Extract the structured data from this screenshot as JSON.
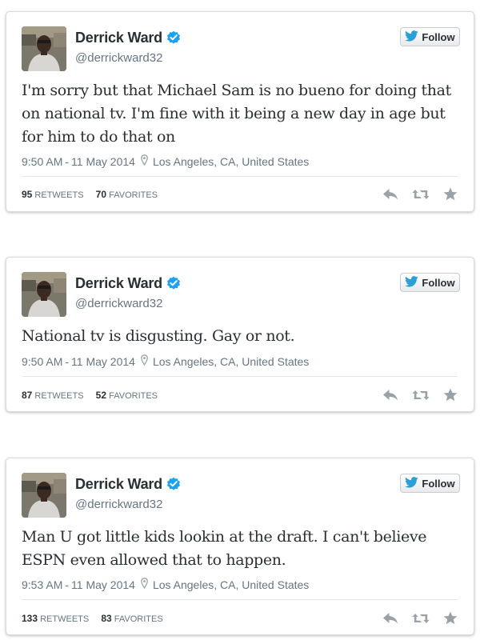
{
  "colors": {
    "verified": "#1da1f2",
    "bird": "#2a9fd8",
    "text": "#292f33",
    "muted": "#66757f",
    "action_icon": "#9aa2a8"
  },
  "tweets": [
    {
      "name": "Derrick Ward",
      "handle": "@derrickward32",
      "follow_label": "Follow",
      "text": "I'm sorry but that Michael Sam is no bueno for doing that on national tv. I'm fine with it being a new day in age but for him to do that on",
      "time": "9:50 AM",
      "date": "11 May 2014",
      "location": "Los Angeles, CA, United States",
      "retweets": "95",
      "retweets_label": "RETWEETS",
      "favorites": "70",
      "favorites_label": "FAVORITES"
    },
    {
      "name": "Derrick Ward",
      "handle": "@derrickward32",
      "follow_label": "Follow",
      "text": "National tv is disgusting. Gay or not.",
      "time": "9:50 AM",
      "date": "11 May 2014",
      "location": "Los Angeles, CA, United States",
      "retweets": "87",
      "retweets_label": "RETWEETS",
      "favorites": "52",
      "favorites_label": "FAVORITES"
    },
    {
      "name": "Derrick Ward",
      "handle": "@derrickward32",
      "follow_label": "Follow",
      "text": "Man U got little kids lookin at the draft. I can't believe ESPN even allowed that to happen.",
      "time": "9:53 AM",
      "date": "11 May 2014",
      "location": "Los Angeles, CA, United States",
      "retweets": "133",
      "retweets_label": "RETWEETS",
      "favorites": "83",
      "favorites_label": "FAVORITES"
    }
  ],
  "icons": {
    "verified": "verified-badge-icon",
    "bird": "twitter-bird-icon",
    "location": "map-pin-icon",
    "reply": "reply-icon",
    "retweet": "retweet-icon",
    "favorite": "star-icon"
  }
}
